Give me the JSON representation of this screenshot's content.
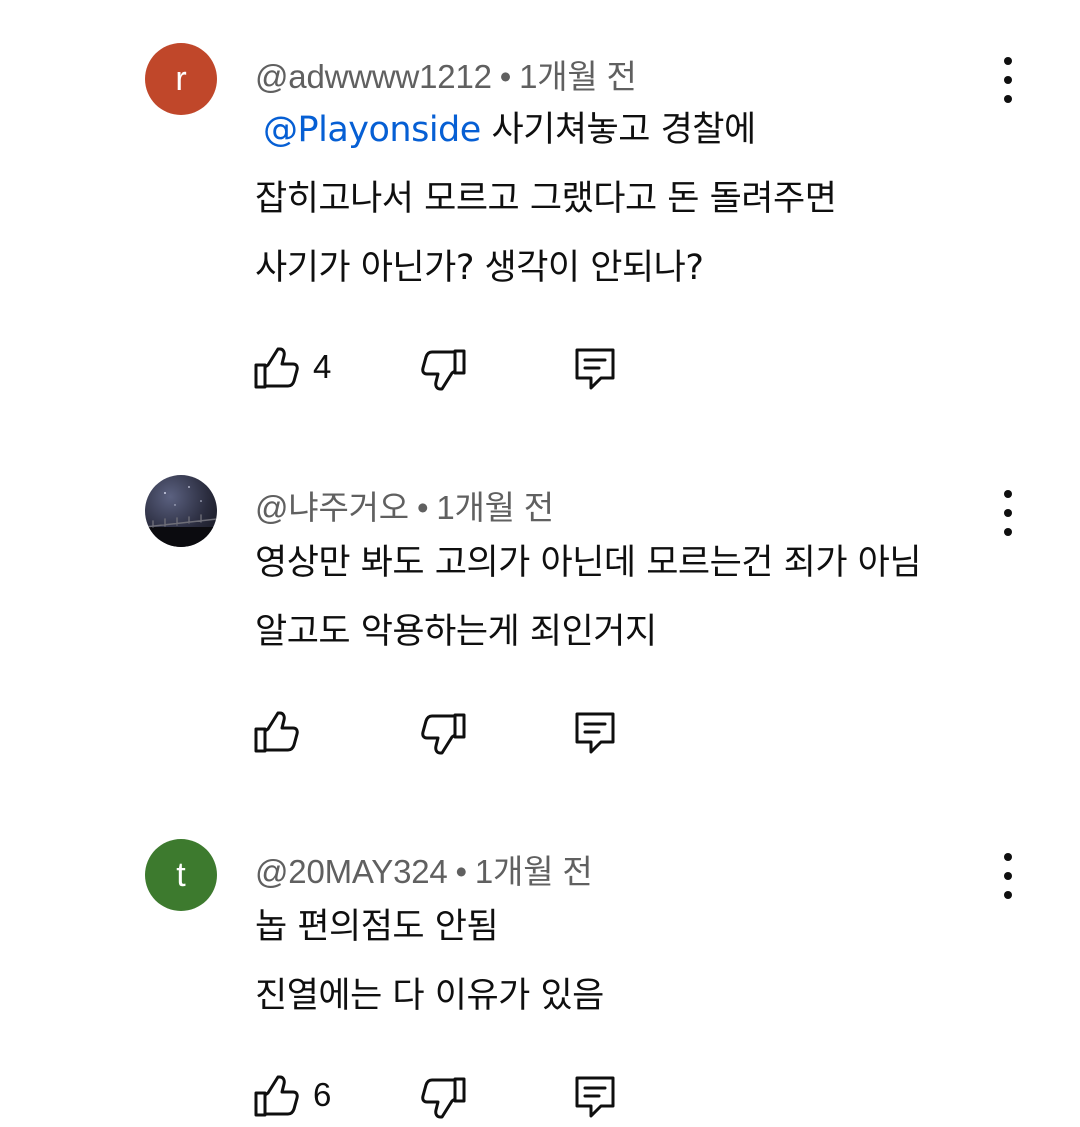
{
  "comments": [
    {
      "avatar_letter": "r",
      "avatar_color": "#c0472a",
      "handle": "@adwwww1212",
      "time": "1개월 전",
      "mention": "@Playonside",
      "lines": [
        "사기쳐놓고 경찰에",
        "잡히고나서 모르고 그랬다고 돈 돌려주면",
        "사기가 아닌가? 생각이 안되나?"
      ],
      "likes": "4"
    },
    {
      "avatar_letter": "",
      "avatar_color": "#2a2c3e",
      "handle": "@냐주거오",
      "time": "1개월 전",
      "lines": [
        "영상만 봐도 고의가 아닌데 모르는건 죄가 아님",
        "알고도 악용하는게 죄인거지"
      ],
      "likes": ""
    },
    {
      "avatar_letter": "t",
      "avatar_color": "#3d7a2e",
      "handle": "@20MAY324",
      "time": "1개월 전",
      "lines": [
        "놉 편의점도 안됨",
        "진열에는 다 이유가 있음"
      ],
      "likes": "6"
    }
  ],
  "icons": {
    "like": "thumb-up-icon",
    "dislike": "thumb-down-icon",
    "reply": "comment-reply-icon",
    "more": "more-vert-icon"
  },
  "separator": "•"
}
